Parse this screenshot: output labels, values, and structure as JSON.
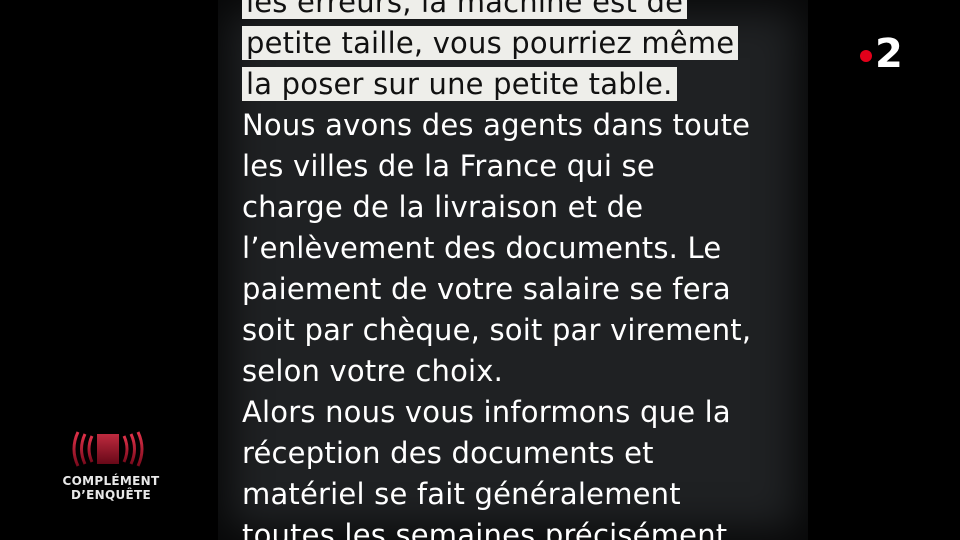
{
  "message": {
    "lines": [
      {
        "text": "les erreurs,  la machine est de",
        "highlight": true
      },
      {
        "text": "petite taille,  vous pourriez même",
        "highlight": true
      },
      {
        "text": "la poser sur une petite table.",
        "highlight": true
      },
      {
        "text": "Nous avons des agents dans toute",
        "highlight": false
      },
      {
        "text": "les villes de la France qui se",
        "highlight": false
      },
      {
        "text": "charge de la livraison et de",
        "highlight": false
      },
      {
        "text": "l’enlèvement des documents. Le",
        "highlight": false
      },
      {
        "text": "paiement de votre salaire se fera",
        "highlight": false
      },
      {
        "text": "soit par chèque, soit par virement,",
        "highlight": false
      },
      {
        "text": "selon votre choix.",
        "highlight": false
      },
      {
        "text": "Alors nous vous informons que la",
        "highlight": false
      },
      {
        "text": "réception des documents et",
        "highlight": false
      },
      {
        "text": "matériel se fait généralement",
        "highlight": false
      },
      {
        "text": "toutes les semaines précisément",
        "highlight": false
      }
    ]
  },
  "channel_logo": {
    "digit": "2",
    "dot_color": "#e2001a"
  },
  "show_logo": {
    "line1": "COMPLÉMENT",
    "line2": "D’ENQUÊTE",
    "accent_color": "#c8102e"
  }
}
